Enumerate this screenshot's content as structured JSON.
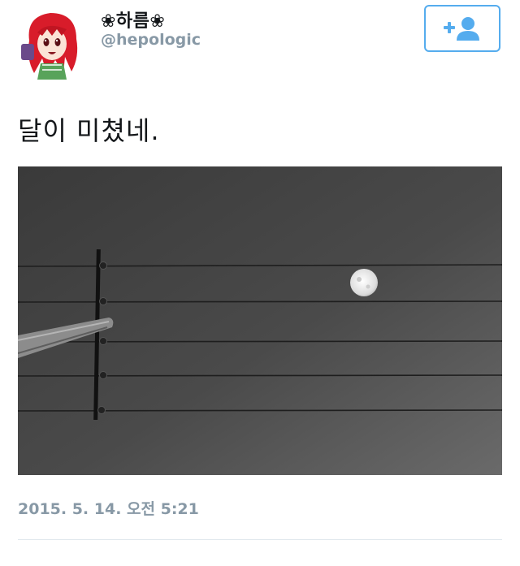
{
  "tweet": {
    "display_name": "❀하름❀",
    "handle": "@hepologic",
    "text": "달이 미쳤네.",
    "timestamp": "2015. 5. 14. 오전 5:21"
  },
  "follow_button": {
    "icon": "add-user-icon"
  },
  "colors": {
    "accent": "#55acee",
    "secondary_text": "#8899a6",
    "primary_text": "#14171a",
    "divider": "#e1e8ed"
  }
}
